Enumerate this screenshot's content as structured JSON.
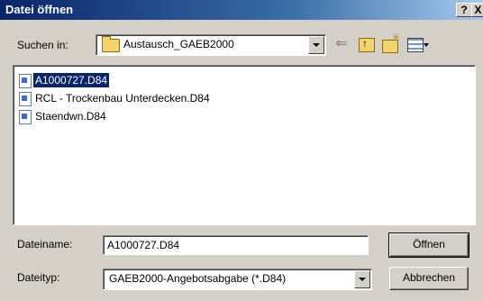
{
  "window": {
    "title": "Datei öffnen",
    "help": "?",
    "close": "X"
  },
  "lookin": {
    "label": "Suchen in:",
    "value": "Austausch_GAEB2000"
  },
  "files": [
    {
      "name": "A1000727.D84",
      "selected": true
    },
    {
      "name": "RCL - Trockenbau  Unterdecken.D84",
      "selected": false
    },
    {
      "name": "Staendwn.D84",
      "selected": false
    }
  ],
  "filename": {
    "label": "Dateiname:",
    "value": "A1000727.D84"
  },
  "filetype": {
    "label": "Dateityp:",
    "value": "GAEB2000-Angebotsabgabe (*.D84)"
  },
  "buttons": {
    "open": "Öffnen",
    "cancel": "Abbrechen"
  },
  "icons": [
    "folder-icon",
    "back-arrow-icon",
    "up-folder-icon",
    "new-folder-icon",
    "view-menu-icon",
    "file-icon"
  ]
}
